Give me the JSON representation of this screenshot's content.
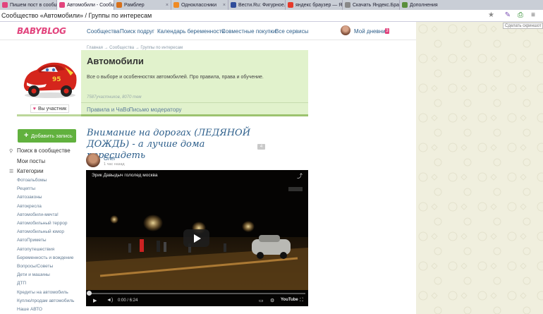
{
  "browser": {
    "tabs": [
      {
        "label": "Пишем пост в сообщ...",
        "icon": "babyblog-favicon",
        "color": "#e2447d",
        "active": false
      },
      {
        "label": "Автомобили - Сообщ...",
        "icon": "babyblog-favicon",
        "color": "#e2447d",
        "active": true
      },
      {
        "label": "Рамблер",
        "icon": "rambler-favicon",
        "color": "#d7701a",
        "active": false
      },
      {
        "label": "Одноклассники",
        "icon": "odnoklassniki-favicon",
        "color": "#f08a24",
        "active": false
      },
      {
        "label": "Вести.Ru: Фигурное...",
        "icon": "vesti-favicon",
        "color": "#2f4c9a",
        "active": false
      },
      {
        "label": "яндекс браузер — Ян...",
        "icon": "yandex-favicon",
        "color": "#e63a2b",
        "active": false
      },
      {
        "label": "Скачать Яндекс.Брау...",
        "icon": "download-favicon",
        "color": "#888888",
        "active": false
      },
      {
        "label": "Дополнения",
        "icon": "puzzle-favicon",
        "color": "#5a8f3c",
        "active": false
      }
    ],
    "address": "Сообщество «Автомобили» / Группы по интересам",
    "tooltip": "Сделать скриншот"
  },
  "header": {
    "logo": "BABYBLOG",
    "nav": [
      "Сообщества",
      "Поиск подруг",
      "Календарь беременности",
      "Совместные покупки",
      "Все сервисы"
    ],
    "my_diary": "Мой дневник",
    "diary_badge": "3"
  },
  "group": {
    "breadcrumb": "Главная → Сообщества → Группы по интересам",
    "title": "Автомобили",
    "description": "Все о выборе и особенностях автомобилей. Про правила, права и обучение.",
    "stats": "7587участников, 8070 тем",
    "links": [
      "Правила и ЧаВо",
      "Письмо модератору"
    ],
    "member_label": "Вы участник"
  },
  "sidebar": {
    "add_post": "Добавить запись",
    "search": "Поиск в сообществе",
    "my_posts": "Мои посты",
    "categories_label": "Категории",
    "categories": [
      "Фотоальбомы",
      "Рецепты",
      "Автозаконы",
      "Автокресла",
      "Автомобили-мечта!",
      "Автомобильный террор",
      "Автомобильный юмор",
      "АвтоПриметы",
      "Автопутешествия",
      "Беременность и вождение",
      "Вопросы/Советы",
      "Дети и машины",
      "ДТП",
      "Кредиты на автомобиль",
      "Куплю/продам автомобиль",
      "Наше АВТО"
    ]
  },
  "post": {
    "title": "Внимание на дорогах (ЛЕДЯНОЙ ДОЖДЬ) - а лучше дома пересидеть",
    "comments": "4",
    "author": "Олег",
    "time": "1 час назад",
    "video": {
      "title": "Эрик Давыдыч гололед москва",
      "time": "0:00 / 6:24",
      "logo": "YouTube",
      "progress": 0
    }
  }
}
